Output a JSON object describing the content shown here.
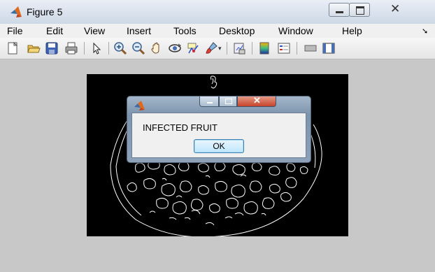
{
  "window": {
    "title": "Figure 5",
    "icon": "matlab-icon",
    "controls": [
      "minimize-icon",
      "maximize-icon",
      "close-icon"
    ],
    "close_glyph": "✕"
  },
  "menubar": {
    "items": [
      "File",
      "Edit",
      "View",
      "Insert",
      "Tools",
      "Desktop",
      "Window",
      "Help"
    ],
    "overflow_glyph": "➘"
  },
  "toolbar": {
    "icons": [
      "new-figure-icon",
      "open-file-icon",
      "save-icon",
      "print-icon",
      "edit-plot-arrow-icon",
      "zoom-in-icon",
      "zoom-out-icon",
      "pan-hand-icon",
      "rotate-3d-icon",
      "data-cursor-icon",
      "brush-icon",
      "link-plot-icon",
      "colorbar-icon",
      "legend-icon",
      "hide-plot-tools-icon",
      "show-plot-tools-icon"
    ]
  },
  "figure": {
    "background_color": "#000000",
    "edge_color": "#ffffff",
    "content": "edge-detected-fruit-image"
  },
  "dialog": {
    "icon": "matlab-icon",
    "message": "INFECTED FRUIT",
    "ok_label": "OK",
    "close_glyph": "✕"
  }
}
